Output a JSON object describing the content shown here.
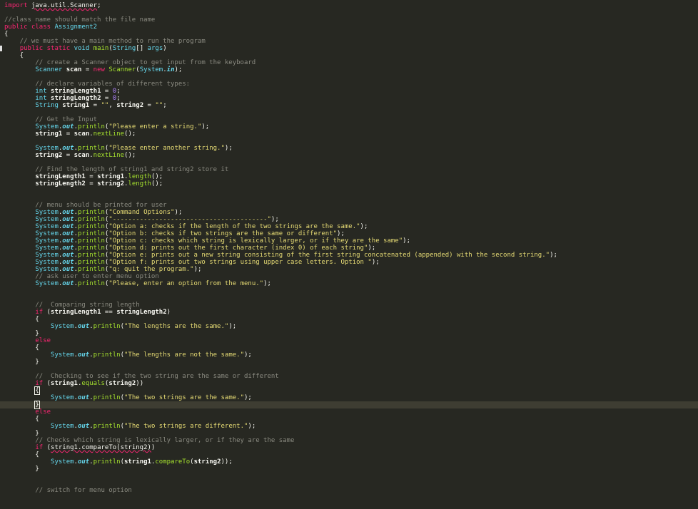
{
  "editor": {
    "language": "java",
    "colors": {
      "background": "#272822",
      "keyword": "#f92672",
      "type": "#66d9ef",
      "function": "#a6e22e",
      "comment": "#8a8a80",
      "string": "#e6db74",
      "number": "#ae81ff",
      "current_line": "#3e3d32"
    },
    "current_line_index": 56,
    "lines": [
      [
        [
          "k",
          "import"
        ],
        [
          "p",
          " "
        ],
        [
          "u",
          "java.util.Scanner"
        ],
        [
          "p",
          ";"
        ]
      ],
      [],
      [
        [
          "c",
          "//class name should match the file name"
        ]
      ],
      [
        [
          "k",
          "public"
        ],
        [
          "p",
          " "
        ],
        [
          "k",
          "class"
        ],
        [
          "p",
          " "
        ],
        [
          "ty",
          "Assignment2"
        ]
      ],
      [
        [
          "p",
          "{"
        ]
      ],
      [
        [
          "c",
          "    // we must have a main method to run the program"
        ]
      ],
      [
        [
          "p",
          "    "
        ],
        [
          "k",
          "public"
        ],
        [
          "p",
          " "
        ],
        [
          "k",
          "static"
        ],
        [
          "p",
          " "
        ],
        [
          "ty",
          "void"
        ],
        [
          "p",
          " "
        ],
        [
          "f",
          "main"
        ],
        [
          "p",
          "("
        ],
        [
          "ty",
          "String"
        ],
        [
          "p",
          "[] "
        ],
        [
          "ty",
          "args"
        ],
        [
          "p",
          ")"
        ]
      ],
      [
        [
          "p",
          "    {"
        ]
      ],
      [
        [
          "c",
          "        // create a Scanner object to get input from the keyboard"
        ]
      ],
      [
        [
          "p",
          "        "
        ],
        [
          "ty",
          "Scanner"
        ],
        [
          "p",
          " "
        ],
        [
          "b",
          "scan"
        ],
        [
          "p",
          " = "
        ],
        [
          "k",
          "new"
        ],
        [
          "p",
          " "
        ],
        [
          "f",
          "Scanner"
        ],
        [
          "p",
          "("
        ],
        [
          "ty",
          "System"
        ],
        [
          "p",
          "."
        ],
        [
          "fi",
          "in"
        ],
        [
          "p",
          ");"
        ]
      ],
      [],
      [
        [
          "c",
          "        // declare variables of different types:"
        ]
      ],
      [
        [
          "p",
          "        "
        ],
        [
          "ty",
          "int"
        ],
        [
          "p",
          " "
        ],
        [
          "b",
          "stringLength1"
        ],
        [
          "p",
          " = "
        ],
        [
          "n",
          "0"
        ],
        [
          "p",
          ";"
        ]
      ],
      [
        [
          "p",
          "        "
        ],
        [
          "ty",
          "int"
        ],
        [
          "p",
          " "
        ],
        [
          "b",
          "stringLength2"
        ],
        [
          "p",
          " = "
        ],
        [
          "n",
          "0"
        ],
        [
          "p",
          ";"
        ]
      ],
      [
        [
          "p",
          "        "
        ],
        [
          "ty",
          "String"
        ],
        [
          "p",
          " "
        ],
        [
          "b",
          "string1"
        ],
        [
          "p",
          " = "
        ],
        [
          "s",
          "\"\""
        ],
        [
          "p",
          ", "
        ],
        [
          "b",
          "string2"
        ],
        [
          "p",
          " = "
        ],
        [
          "s",
          "\"\""
        ],
        [
          "p",
          ";"
        ]
      ],
      [],
      [
        [
          "c",
          "        // Get the Input"
        ]
      ],
      [
        [
          "p",
          "        "
        ],
        [
          "ty",
          "System"
        ],
        [
          "p",
          "."
        ],
        [
          "fi",
          "out"
        ],
        [
          "p",
          "."
        ],
        [
          "f",
          "println"
        ],
        [
          "p",
          "("
        ],
        [
          "s",
          "\"Please enter a string.\""
        ],
        [
          "p",
          ");"
        ]
      ],
      [
        [
          "p",
          "        "
        ],
        [
          "b",
          "string1"
        ],
        [
          "p",
          " = "
        ],
        [
          "b",
          "scan"
        ],
        [
          "p",
          "."
        ],
        [
          "f",
          "nextLine"
        ],
        [
          "p",
          "();"
        ]
      ],
      [],
      [
        [
          "p",
          "        "
        ],
        [
          "ty",
          "System"
        ],
        [
          "p",
          "."
        ],
        [
          "fi",
          "out"
        ],
        [
          "p",
          "."
        ],
        [
          "f",
          "println"
        ],
        [
          "p",
          "("
        ],
        [
          "s",
          "\"Please enter another string.\""
        ],
        [
          "p",
          ");"
        ]
      ],
      [
        [
          "p",
          "        "
        ],
        [
          "b",
          "string2"
        ],
        [
          "p",
          " = "
        ],
        [
          "b",
          "scan"
        ],
        [
          "p",
          "."
        ],
        [
          "f",
          "nextLine"
        ],
        [
          "p",
          "();"
        ]
      ],
      [],
      [
        [
          "c",
          "        // Find the length of string1 and string2 store it"
        ]
      ],
      [
        [
          "p",
          "        "
        ],
        [
          "b",
          "stringLength1"
        ],
        [
          "p",
          " = "
        ],
        [
          "b",
          "string1"
        ],
        [
          "p",
          "."
        ],
        [
          "f",
          "length"
        ],
        [
          "p",
          "();"
        ]
      ],
      [
        [
          "p",
          "        "
        ],
        [
          "b",
          "stringLength2"
        ],
        [
          "p",
          " = "
        ],
        [
          "b",
          "string2"
        ],
        [
          "p",
          "."
        ],
        [
          "f",
          "length"
        ],
        [
          "p",
          "();"
        ]
      ],
      [],
      [],
      [
        [
          "c",
          "        // menu should be printed for user"
        ]
      ],
      [
        [
          "p",
          "        "
        ],
        [
          "ty",
          "System"
        ],
        [
          "p",
          "."
        ],
        [
          "fi",
          "out"
        ],
        [
          "p",
          "."
        ],
        [
          "f",
          "println"
        ],
        [
          "p",
          "("
        ],
        [
          "s",
          "\"Command Options\""
        ],
        [
          "p",
          ");"
        ]
      ],
      [
        [
          "p",
          "        "
        ],
        [
          "ty",
          "System"
        ],
        [
          "p",
          "."
        ],
        [
          "fi",
          "out"
        ],
        [
          "p",
          "."
        ],
        [
          "f",
          "println"
        ],
        [
          "p",
          "("
        ],
        [
          "s",
          "\"----------------------------------------\""
        ],
        [
          "p",
          ");"
        ]
      ],
      [
        [
          "p",
          "        "
        ],
        [
          "ty",
          "System"
        ],
        [
          "p",
          "."
        ],
        [
          "fi",
          "out"
        ],
        [
          "p",
          "."
        ],
        [
          "f",
          "println"
        ],
        [
          "p",
          "("
        ],
        [
          "s",
          "\"Option a: checks if the length of the two strings are the same.\""
        ],
        [
          "p",
          ");"
        ]
      ],
      [
        [
          "p",
          "        "
        ],
        [
          "ty",
          "System"
        ],
        [
          "p",
          "."
        ],
        [
          "fi",
          "out"
        ],
        [
          "p",
          "."
        ],
        [
          "f",
          "println"
        ],
        [
          "p",
          "("
        ],
        [
          "s",
          "\"Option b: checks if two strings are the same or different\""
        ],
        [
          "p",
          ");"
        ]
      ],
      [
        [
          "p",
          "        "
        ],
        [
          "ty",
          "System"
        ],
        [
          "p",
          "."
        ],
        [
          "fi",
          "out"
        ],
        [
          "p",
          "."
        ],
        [
          "f",
          "println"
        ],
        [
          "p",
          "("
        ],
        [
          "s",
          "\"Option c: checks which string is lexically larger, or if they are the same\""
        ],
        [
          "p",
          ");"
        ]
      ],
      [
        [
          "p",
          "        "
        ],
        [
          "ty",
          "System"
        ],
        [
          "p",
          "."
        ],
        [
          "fi",
          "out"
        ],
        [
          "p",
          "."
        ],
        [
          "f",
          "println"
        ],
        [
          "p",
          "("
        ],
        [
          "s",
          "\"Option d: prints out the first character (index 0) of each string\""
        ],
        [
          "p",
          ");"
        ]
      ],
      [
        [
          "p",
          "        "
        ],
        [
          "ty",
          "System"
        ],
        [
          "p",
          "."
        ],
        [
          "fi",
          "out"
        ],
        [
          "p",
          "."
        ],
        [
          "f",
          "println"
        ],
        [
          "p",
          "("
        ],
        [
          "s",
          "\"Option e: prints out a new string consisting of the first string concatenated (appended) with the second string.\""
        ],
        [
          "p",
          ");"
        ]
      ],
      [
        [
          "p",
          "        "
        ],
        [
          "ty",
          "System"
        ],
        [
          "p",
          "."
        ],
        [
          "fi",
          "out"
        ],
        [
          "p",
          "."
        ],
        [
          "f",
          "println"
        ],
        [
          "p",
          "("
        ],
        [
          "s",
          "\"Option f: prints out two strings using upper case letters. Option \""
        ],
        [
          "p",
          ");"
        ]
      ],
      [
        [
          "p",
          "        "
        ],
        [
          "ty",
          "System"
        ],
        [
          "p",
          "."
        ],
        [
          "fi",
          "out"
        ],
        [
          "p",
          "."
        ],
        [
          "f",
          "println"
        ],
        [
          "p",
          "("
        ],
        [
          "s",
          "\"q: quit the program.\""
        ],
        [
          "p",
          ");"
        ]
      ],
      [
        [
          "c",
          "        // ask user to enter menu option"
        ]
      ],
      [
        [
          "p",
          "        "
        ],
        [
          "ty",
          "System"
        ],
        [
          "p",
          "."
        ],
        [
          "fi",
          "out"
        ],
        [
          "p",
          "."
        ],
        [
          "f",
          "println"
        ],
        [
          "p",
          "("
        ],
        [
          "s",
          "\"Please, enter an option from the menu.\""
        ],
        [
          "p",
          ");"
        ]
      ],
      [],
      [],
      [
        [
          "c",
          "        //  Comparing string length"
        ]
      ],
      [
        [
          "p",
          "        "
        ],
        [
          "k",
          "if"
        ],
        [
          "p",
          " ("
        ],
        [
          "b",
          "stringLength1"
        ],
        [
          "p",
          " == "
        ],
        [
          "b",
          "stringLength2"
        ],
        [
          "p",
          ")"
        ]
      ],
      [
        [
          "p",
          "        {"
        ]
      ],
      [
        [
          "p",
          "            "
        ],
        [
          "ty",
          "System"
        ],
        [
          "p",
          "."
        ],
        [
          "fi",
          "out"
        ],
        [
          "p",
          "."
        ],
        [
          "f",
          "println"
        ],
        [
          "p",
          "("
        ],
        [
          "s",
          "\"The lengths are the same.\""
        ],
        [
          "p",
          ");"
        ]
      ],
      [
        [
          "p",
          "        }"
        ]
      ],
      [
        [
          "p",
          "        "
        ],
        [
          "k",
          "else"
        ]
      ],
      [
        [
          "p",
          "        {"
        ]
      ],
      [
        [
          "p",
          "            "
        ],
        [
          "ty",
          "System"
        ],
        [
          "p",
          "."
        ],
        [
          "fi",
          "out"
        ],
        [
          "p",
          "."
        ],
        [
          "f",
          "println"
        ],
        [
          "p",
          "("
        ],
        [
          "s",
          "\"The lengths are not the same.\""
        ],
        [
          "p",
          ");"
        ]
      ],
      [
        [
          "p",
          "        }"
        ]
      ],
      [],
      [
        [
          "c",
          "        //  Checking to see if the two string are the same or different"
        ]
      ],
      [
        [
          "p",
          "        "
        ],
        [
          "k",
          "if"
        ],
        [
          "p",
          " ("
        ],
        [
          "b",
          "string1"
        ],
        [
          "p",
          "."
        ],
        [
          "f",
          "equals"
        ],
        [
          "p",
          "("
        ],
        [
          "b",
          "string2"
        ],
        [
          "p",
          "))"
        ]
      ],
      [
        [
          "p",
          "        "
        ],
        [
          "cur",
          "{"
        ]
      ],
      [
        [
          "p",
          "            "
        ],
        [
          "ty",
          "System"
        ],
        [
          "p",
          "."
        ],
        [
          "fi",
          "out"
        ],
        [
          "p",
          "."
        ],
        [
          "f",
          "println"
        ],
        [
          "p",
          "("
        ],
        [
          "s",
          "\"The two strings are the same.\""
        ],
        [
          "p",
          ");"
        ]
      ],
      [
        [
          "p",
          "        "
        ],
        [
          "cur",
          "}"
        ]
      ],
      [
        [
          "p",
          "        "
        ],
        [
          "k",
          "else"
        ]
      ],
      [
        [
          "p",
          "        {"
        ]
      ],
      [
        [
          "p",
          "            "
        ],
        [
          "ty",
          "System"
        ],
        [
          "p",
          "."
        ],
        [
          "fi",
          "out"
        ],
        [
          "p",
          "."
        ],
        [
          "f",
          "println"
        ],
        [
          "p",
          "("
        ],
        [
          "s",
          "\"The two strings are different.\""
        ],
        [
          "p",
          ");"
        ]
      ],
      [
        [
          "p",
          "        }"
        ]
      ],
      [
        [
          "c",
          "        // Checks which string is lexically larger, or if they are the same"
        ]
      ],
      [
        [
          "p",
          "        "
        ],
        [
          "k",
          "if"
        ],
        [
          "p",
          " ("
        ],
        [
          "u",
          "string1.compareTo(string2)"
        ],
        [
          "p",
          ")"
        ]
      ],
      [
        [
          "p",
          "        {"
        ]
      ],
      [
        [
          "p",
          "            "
        ],
        [
          "ty",
          "System"
        ],
        [
          "p",
          "."
        ],
        [
          "fi",
          "out"
        ],
        [
          "p",
          "."
        ],
        [
          "f",
          "println"
        ],
        [
          "p",
          "("
        ],
        [
          "b",
          "string1"
        ],
        [
          "p",
          "."
        ],
        [
          "f",
          "compareTo"
        ],
        [
          "p",
          "("
        ],
        [
          "b",
          "string2"
        ],
        [
          "p",
          "));"
        ]
      ],
      [
        [
          "p",
          "        }"
        ]
      ],
      [],
      [],
      [
        [
          "c",
          "        // switch for menu option"
        ]
      ]
    ]
  }
}
